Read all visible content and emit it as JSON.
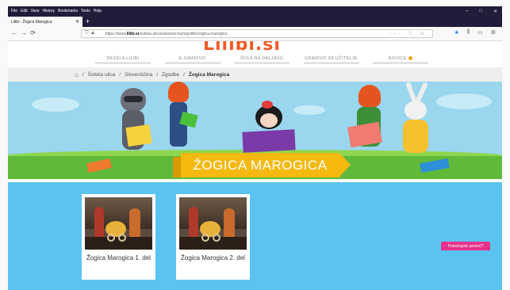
{
  "browser": {
    "menu": [
      "File",
      "Edit",
      "View",
      "History",
      "Bookmarks",
      "Tools",
      "Help"
    ],
    "tab_title": "Lilibi - Žogica Marogica",
    "url_prefix": "https://www.",
    "url_host": "lilibi.si",
    "url_path": "/solska-ulica/slovenscina/zgodbe/zogica-marogica"
  },
  "site": {
    "logo": "Lilibi.si",
    "nav": [
      {
        "label": "DEŽELA LILIBI"
      },
      {
        "label": "E-GRADIVO"
      },
      {
        "label": "ŠOLA NA DALJAVO"
      },
      {
        "label": "GRADIVO ZA UČITELJE"
      },
      {
        "label": "NOVICE"
      }
    ],
    "breadcrumb": [
      "Šolska ulica",
      "Slovenščina",
      "Zgodbe",
      "Žogica Marogica"
    ],
    "hero_title": "ŽOGICA MAROGICA",
    "cards": [
      {
        "caption": "Žogica Marogica 1. del"
      },
      {
        "caption": "Žogica Marogica 2. del"
      }
    ],
    "help_label": "Potrebujete pomoč?"
  }
}
